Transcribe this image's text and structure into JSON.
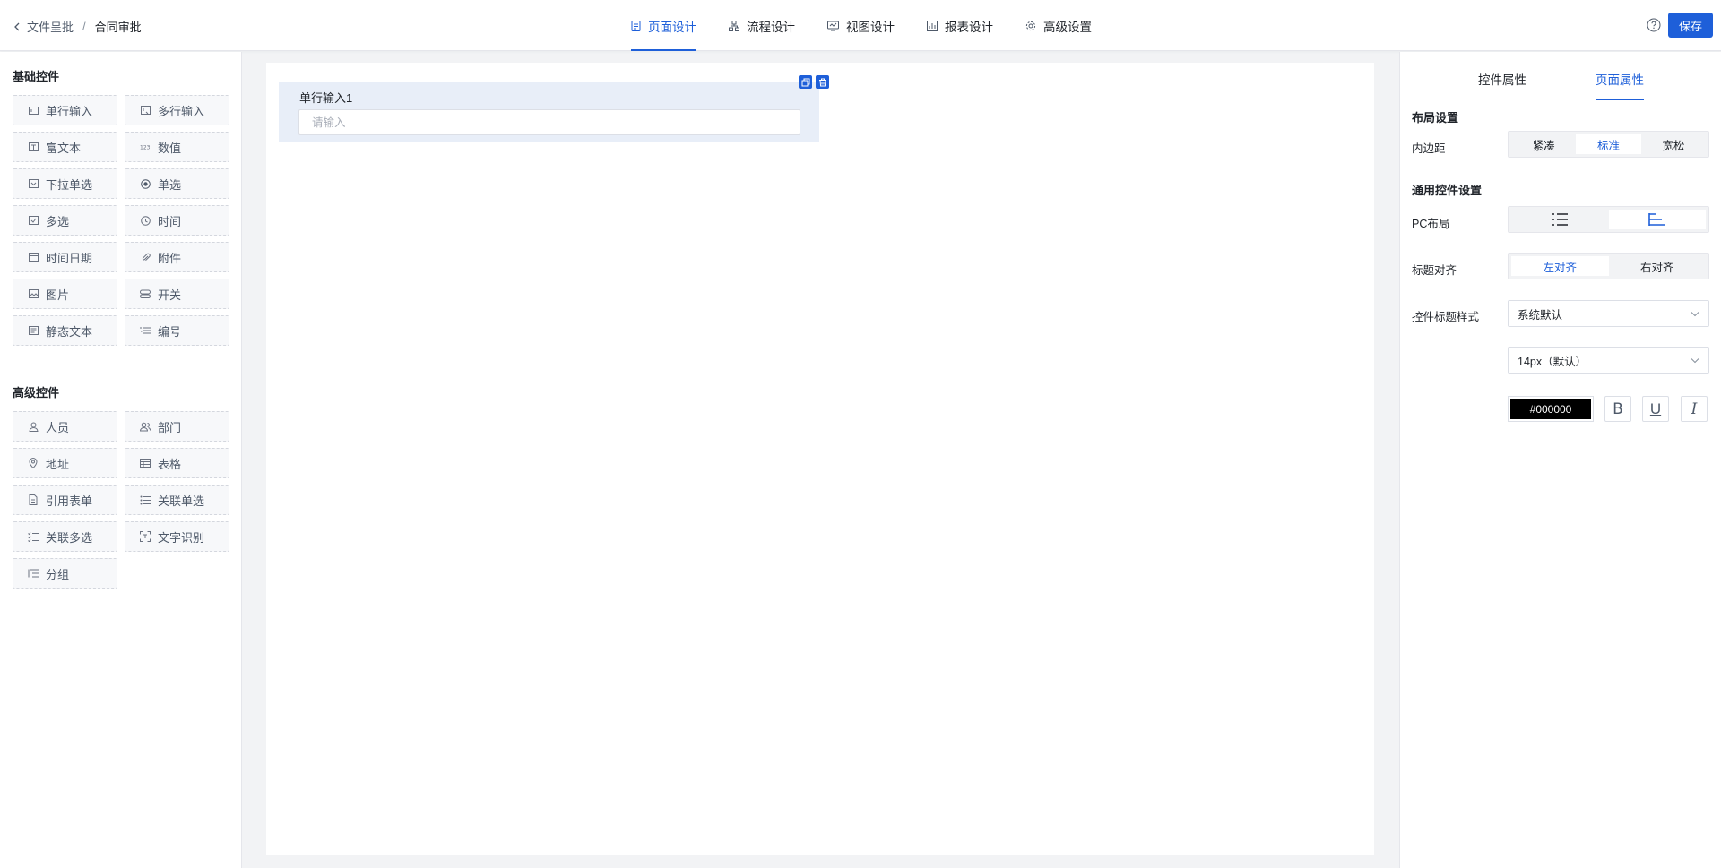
{
  "breadcrumb": {
    "parent": "文件呈批",
    "separator": "/",
    "current": "合同审批"
  },
  "tabs": [
    {
      "label": "页面设计",
      "icon": "page-icon",
      "active": true
    },
    {
      "label": "流程设计",
      "icon": "flow-icon",
      "active": false
    },
    {
      "label": "视图设计",
      "icon": "view-icon",
      "active": false
    },
    {
      "label": "报表设计",
      "icon": "report-icon",
      "active": false
    },
    {
      "label": "高级设置",
      "icon": "gear-icon",
      "active": false
    }
  ],
  "header": {
    "save_label": "保存"
  },
  "left": {
    "basic_title": "基础控件",
    "basic": [
      {
        "label": "单行输入",
        "icon": "single-line-icon"
      },
      {
        "label": "多行输入",
        "icon": "multi-line-icon"
      },
      {
        "label": "富文本",
        "icon": "rich-text-icon"
      },
      {
        "label": "数值",
        "icon": "number-icon"
      },
      {
        "label": "下拉单选",
        "icon": "dropdown-icon"
      },
      {
        "label": "单选",
        "icon": "radio-icon"
      },
      {
        "label": "多选",
        "icon": "checkbox-icon"
      },
      {
        "label": "时间",
        "icon": "clock-icon"
      },
      {
        "label": "时间日期",
        "icon": "calendar-icon"
      },
      {
        "label": "附件",
        "icon": "paperclip-icon"
      },
      {
        "label": "图片",
        "icon": "image-icon"
      },
      {
        "label": "开关",
        "icon": "switch-icon"
      },
      {
        "label": "静态文本",
        "icon": "static-text-icon"
      },
      {
        "label": "编号",
        "icon": "numbered-list-icon"
      }
    ],
    "advanced_title": "高级控件",
    "advanced": [
      {
        "label": "人员",
        "icon": "person-icon"
      },
      {
        "label": "部门",
        "icon": "department-icon"
      },
      {
        "label": "地址",
        "icon": "location-icon"
      },
      {
        "label": "表格",
        "icon": "table-icon"
      },
      {
        "label": "引用表单",
        "icon": "document-icon"
      },
      {
        "label": "关联单选",
        "icon": "linked-list-icon"
      },
      {
        "label": "关联多选",
        "icon": "linked-checklist-icon"
      },
      {
        "label": "文字识别",
        "icon": "ocr-scan-icon"
      },
      {
        "label": "分组",
        "icon": "group-icon"
      }
    ]
  },
  "canvas": {
    "field_label": "单行输入1",
    "field_placeholder": "请输入"
  },
  "right": {
    "tabs": [
      {
        "label": "控件属性",
        "active": false
      },
      {
        "label": "页面属性",
        "active": true
      }
    ],
    "layout_title": "布局设置",
    "padding_label": "内边距",
    "padding_options": [
      {
        "label": "紧凑",
        "on": false
      },
      {
        "label": "标准",
        "on": true
      },
      {
        "label": "宽松",
        "on": false
      }
    ],
    "common_title": "通用控件设置",
    "pc_layout_label": "PC布局",
    "pc_layout_options": [
      {
        "icon": "list-vertical-icon",
        "on": false
      },
      {
        "icon": "list-horizontal-icon",
        "on": true
      }
    ],
    "title_align_label": "标题对齐",
    "title_align_options": [
      {
        "label": "左对齐",
        "on": true
      },
      {
        "label": "右对齐",
        "on": false
      }
    ],
    "title_style_label": "控件标题样式",
    "font_family_value": "系统默认",
    "font_size_value": "14px（默认）",
    "color_value": "#000000",
    "format_buttons": [
      "B",
      "U",
      "I"
    ]
  },
  "colors": {
    "accent": "#1e5fd9",
    "field_selected_bg": "#e8eef8",
    "canvas_bg": "#f2f3f5"
  }
}
